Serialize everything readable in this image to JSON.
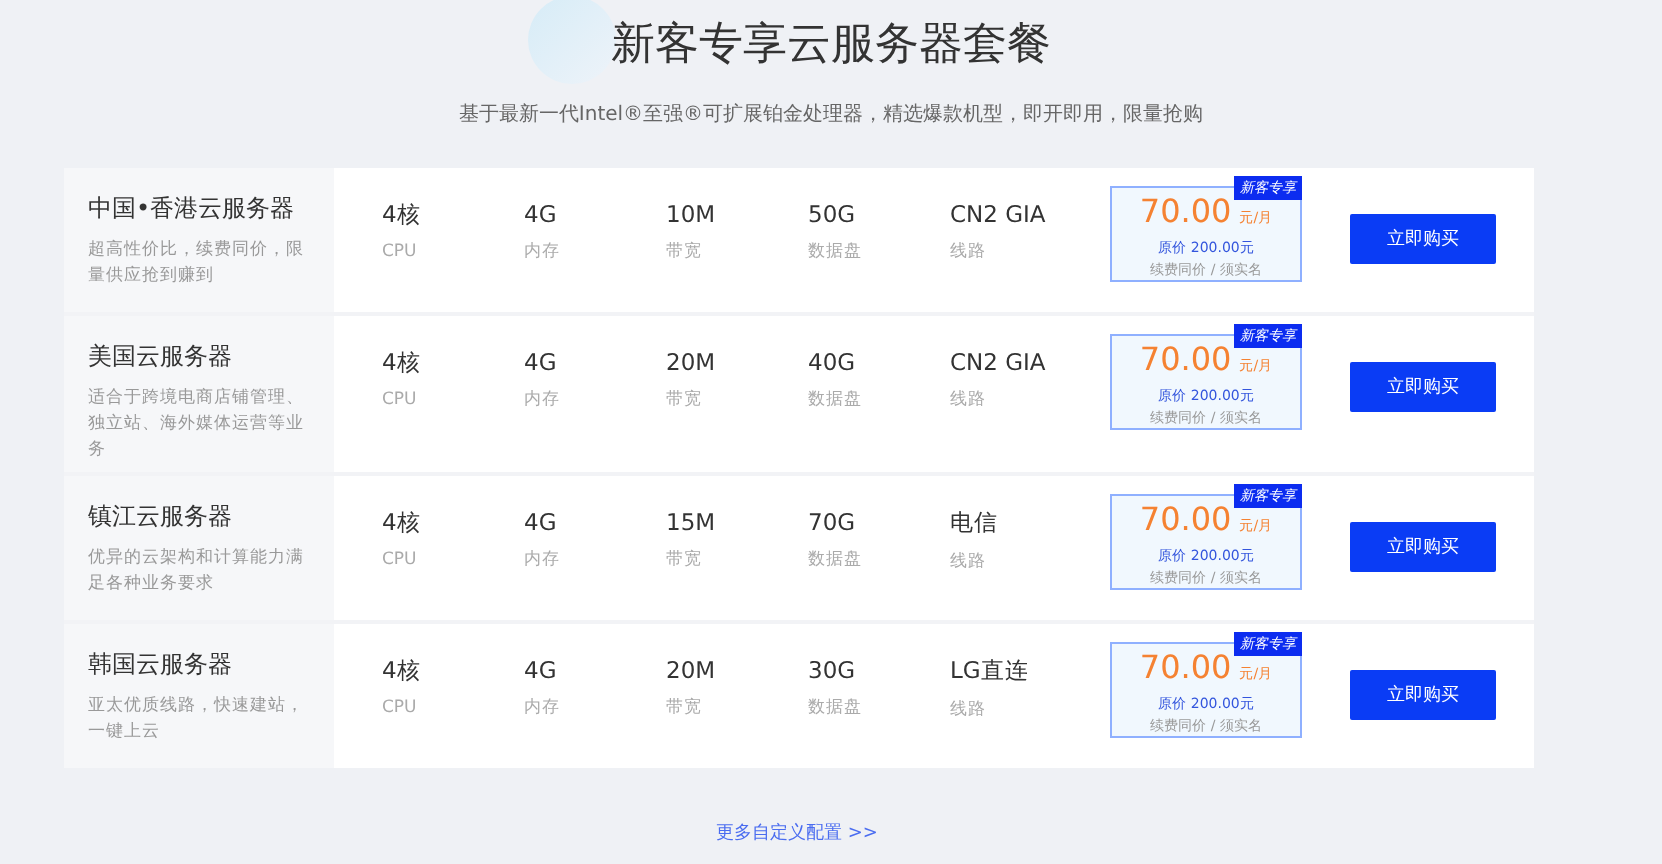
{
  "heading": {
    "title": "新客专享云服务器套餐",
    "subtitle": "基于最新一代Intel®至强®可扩展铂金处理器，精选爆款机型，即开即用，限量抢购"
  },
  "plans": [
    {
      "name": "中国•香港云服务器",
      "description": "超高性价比，续费同价，限量供应抢到赚到",
      "specs": [
        {
          "value": "4核",
          "label": "CPU"
        },
        {
          "value": "4G",
          "label": "内存"
        },
        {
          "value": "10M",
          "label": "带宽"
        },
        {
          "value": "50G",
          "label": "数据盘"
        },
        {
          "value": "CN2 GIA",
          "label": "线路"
        }
      ],
      "badge": "新客专享",
      "price": "70.00",
      "unit": "元/月",
      "original_price": "原价 200.00元",
      "note": "续费同价 / 须实名",
      "button": "立即购买"
    },
    {
      "name": "美国云服务器",
      "description": "适合于跨境电商店铺管理、独立站、海外媒体运营等业务",
      "specs": [
        {
          "value": "4核",
          "label": "CPU"
        },
        {
          "value": "4G",
          "label": "内存"
        },
        {
          "value": "20M",
          "label": "带宽"
        },
        {
          "value": "40G",
          "label": "数据盘"
        },
        {
          "value": "CN2 GIA",
          "label": "线路"
        }
      ],
      "badge": "新客专享",
      "price": "70.00",
      "unit": "元/月",
      "original_price": "原价 200.00元",
      "note": "续费同价 / 须实名",
      "button": "立即购买"
    },
    {
      "name": "镇江云服务器",
      "description": "优异的云架构和计算能力满足各种业务要求",
      "specs": [
        {
          "value": "4核",
          "label": "CPU"
        },
        {
          "value": "4G",
          "label": "内存"
        },
        {
          "value": "15M",
          "label": "带宽"
        },
        {
          "value": "70G",
          "label": "数据盘"
        },
        {
          "value": "电信",
          "label": "线路"
        }
      ],
      "badge": "新客专享",
      "price": "70.00",
      "unit": "元/月",
      "original_price": "原价 200.00元",
      "note": "续费同价 / 须实名",
      "button": "立即购买"
    },
    {
      "name": "韩国云服务器",
      "description": "亚太优质线路，快速建站，一键上云",
      "specs": [
        {
          "value": "4核",
          "label": "CPU"
        },
        {
          "value": "4G",
          "label": "内存"
        },
        {
          "value": "20M",
          "label": "带宽"
        },
        {
          "value": "30G",
          "label": "数据盘"
        },
        {
          "value": "LG直连",
          "label": "线路"
        }
      ],
      "badge": "新客专享",
      "price": "70.00",
      "unit": "元/月",
      "original_price": "原价 200.00元",
      "note": "续费同价 / 须实名",
      "button": "立即购买"
    }
  ],
  "more_link": "更多自定义配置 >>"
}
